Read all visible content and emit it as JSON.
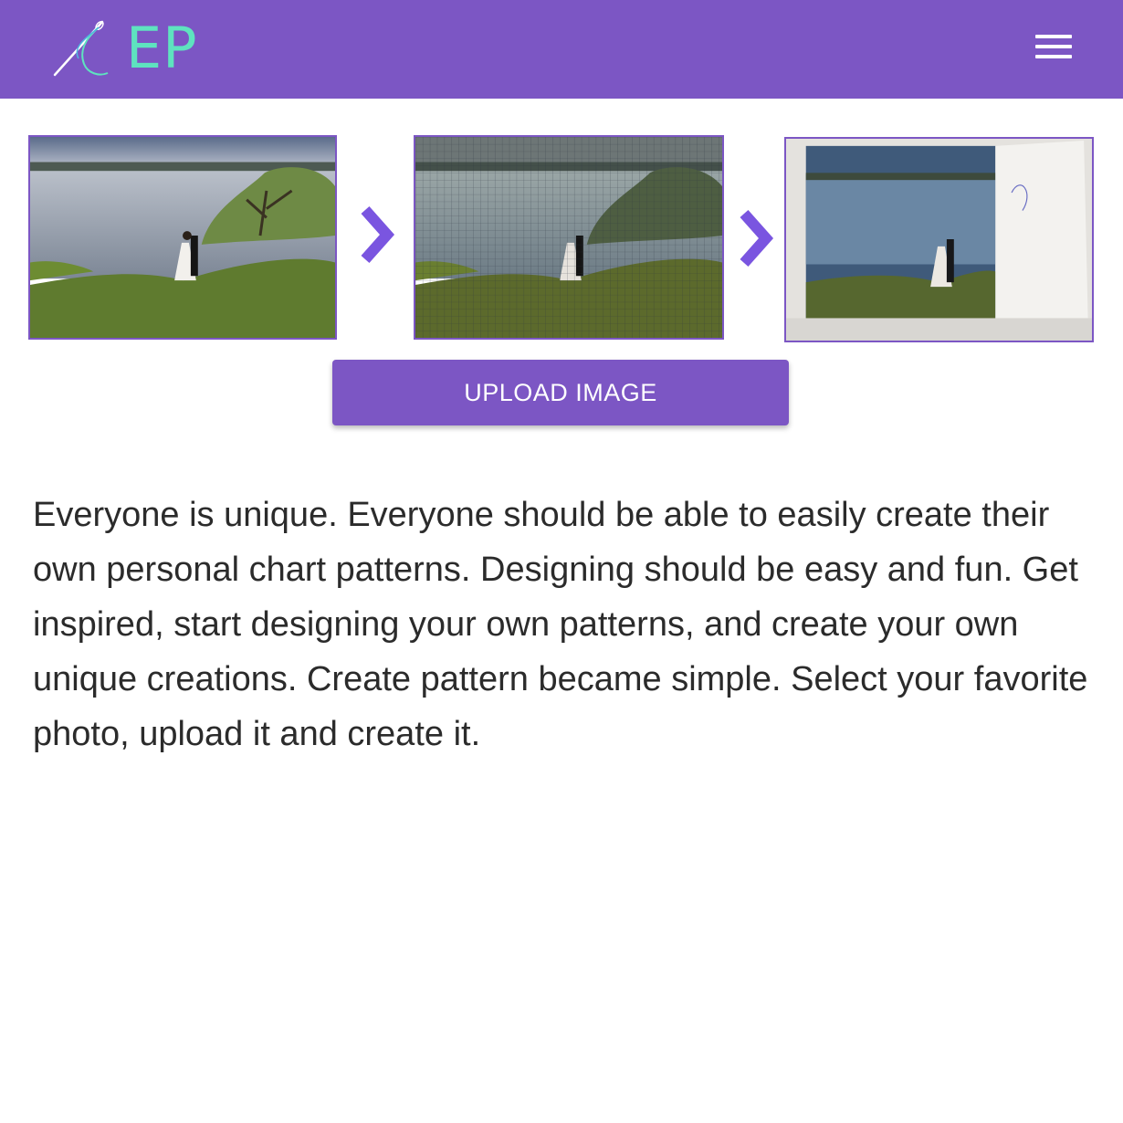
{
  "header": {
    "logo_text": "EP",
    "logo_icon": "needle-thread-icon",
    "menu_icon": "hamburger-menu-icon",
    "background_color": "#7c56c4",
    "logo_text_color": "#5ee3bf"
  },
  "steps": {
    "original_photo_icon": "photo-image",
    "pattern_chart_icon": "grid-pattern-image",
    "finished_stitch_icon": "cross-stitch-image",
    "arrow_icon": "chevron-right-icon",
    "arrow_color": "#7a55e0"
  },
  "upload": {
    "label": "UPLOAD IMAGE"
  },
  "description": {
    "text": "Everyone is unique. Everyone should be able to easily create their own personal chart patterns. Designing should be easy and fun. Get inspired, start designing your own patterns, and create your own unique creations. Create pattern became simple. Select your favorite photo, upload it and create it."
  }
}
